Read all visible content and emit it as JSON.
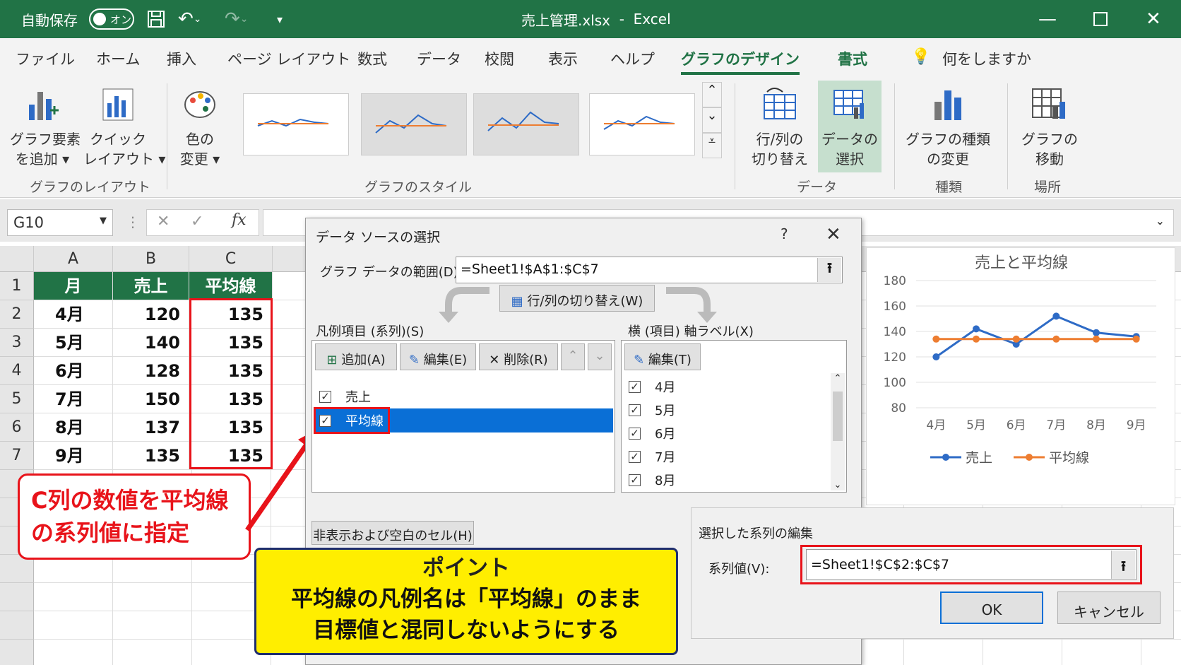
{
  "titlebar": {
    "autosave": "自動保存",
    "toggle": "オン",
    "title": "売上管理.xlsx",
    "sep": "-",
    "app": "Excel"
  },
  "menu": [
    "ファイル",
    "ホーム",
    "挿入",
    "ページ レイアウト",
    "数式",
    "データ",
    "校閲",
    "表示",
    "ヘルプ",
    "グラフのデザイン",
    "書式"
  ],
  "tellme": "何をしますか",
  "ribbon": {
    "add_elem": [
      "グラフ要素",
      "を追加 ▾"
    ],
    "quick": [
      "クイック",
      "レイアウト ▾"
    ],
    "color": [
      "色の",
      "変更 ▾"
    ],
    "switch": [
      "行/列の",
      "切り替え"
    ],
    "select": [
      "データの",
      "選択"
    ],
    "change": [
      "グラフの種類",
      "の変更"
    ],
    "move": [
      "グラフの",
      "移動"
    ],
    "groups": {
      "layout": "グラフのレイアウト",
      "style": "グラフのスタイル",
      "data": "データ",
      "kind": "種類",
      "place": "場所"
    }
  },
  "namebox": "G10",
  "sheet": {
    "cols": [
      "A",
      "B",
      "C"
    ],
    "header": [
      "月",
      "売上",
      "平均線"
    ],
    "rows": [
      [
        "4月",
        "120",
        "135"
      ],
      [
        "5月",
        "140",
        "135"
      ],
      [
        "6月",
        "128",
        "135"
      ],
      [
        "7月",
        "150",
        "135"
      ],
      [
        "8月",
        "137",
        "135"
      ],
      [
        "9月",
        "135",
        "135"
      ]
    ]
  },
  "callout": [
    "C列の数値を平均線",
    "の系列値に指定"
  ],
  "dialog": {
    "title": "データ ソースの選択",
    "help": "?",
    "close": "✕",
    "range_label": "グラフ データの範囲(D):",
    "range_value": "=Sheet1!$A$1:$C$7",
    "switch_btn": "行/列の切り替え(W)",
    "legend_label": "凡例項目 (系列)(S)",
    "axis_label": "横 (項目) 軸ラベル(X)",
    "add_btn": "追加(A)",
    "edit_btn": "編集(E)",
    "del_btn": "削除(R)",
    "edit_axis_btn": "編集(T)",
    "series": [
      "売上",
      "平均線"
    ],
    "axis_items": [
      "4月",
      "5月",
      "6月",
      "7月",
      "8月"
    ],
    "hidden_btn": "非表示および空白のセル(H)"
  },
  "panel": {
    "title": "選択した系列の編集",
    "label": "系列値(V):",
    "value": "=Sheet1!$C$2:$C$7",
    "ok": "OK",
    "cancel": "キャンセル"
  },
  "point": {
    "title": "ポイント",
    "line1": "平均線の凡例名は「平均線」のまま",
    "line2": "目標値と混同しないようにする"
  },
  "chart_data": {
    "type": "line",
    "title": "売上と平均線",
    "categories": [
      "4月",
      "5月",
      "6月",
      "7月",
      "8月",
      "9月"
    ],
    "series": [
      {
        "name": "売上",
        "values": [
          120,
          142,
          130,
          152,
          139,
          136
        ],
        "color": "#2e6bc6"
      },
      {
        "name": "平均線",
        "values": [
          134,
          134,
          134,
          134,
          134,
          134
        ],
        "color": "#ed7d31"
      }
    ],
    "ylim": [
      80,
      180
    ],
    "yticks": [
      80,
      100,
      120,
      140,
      160,
      180
    ],
    "legend": "bottom"
  }
}
